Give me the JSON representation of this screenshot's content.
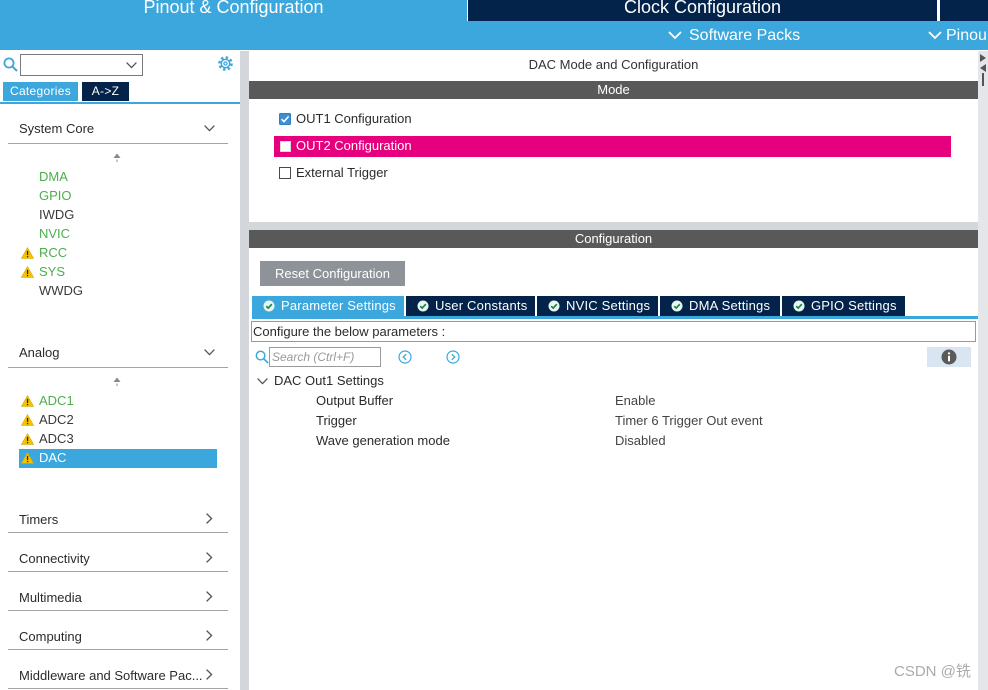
{
  "colors": {
    "accent_blue": "#3ca7dc",
    "navy": "#03234b",
    "enabled_green": "#4cae4c",
    "highlight_magenta": "#e6007e",
    "section_header_gray": "#595959",
    "warning_yellow": "#f5c400"
  },
  "icons": {
    "left_search": "search-icon",
    "left_settings": "gear-icon",
    "peripheral_warning": "warning-icon",
    "tab_status": "check-circle-icon",
    "search_previous": "previous-arrow-icon",
    "search_next": "next-arrow-icon",
    "info": "info-icon"
  },
  "top_tabs": {
    "pinout_label": "Pinout & Configuration",
    "clock_label": "Clock Configuration"
  },
  "sub_menu": {
    "software_packs_label": "Software Packs",
    "pinout_label": "Pinou"
  },
  "left_panel": {
    "search_dropdown_value": "",
    "view_tabs": [
      {
        "label": "Categories",
        "active": true
      },
      {
        "label": "A->Z",
        "active": false
      }
    ],
    "categories": [
      {
        "label": "System Core",
        "expanded": true,
        "items": [
          {
            "label": "DMA",
            "enabled": true,
            "warning": false
          },
          {
            "label": "GPIO",
            "enabled": true,
            "warning": false
          },
          {
            "label": "IWDG",
            "enabled": false,
            "warning": false
          },
          {
            "label": "NVIC",
            "enabled": true,
            "warning": false
          },
          {
            "label": "RCC",
            "enabled": true,
            "warning": true
          },
          {
            "label": "SYS",
            "enabled": true,
            "warning": true
          },
          {
            "label": "WWDG",
            "enabled": false,
            "warning": false
          }
        ]
      },
      {
        "label": "Analog",
        "expanded": true,
        "items": [
          {
            "label": "ADC1",
            "enabled": true,
            "warning": true
          },
          {
            "label": "ADC2",
            "enabled": false,
            "warning": true
          },
          {
            "label": "ADC3",
            "enabled": false,
            "warning": true
          },
          {
            "label": "DAC",
            "enabled": false,
            "warning": true,
            "selected": true
          }
        ]
      },
      {
        "label": "Timers",
        "expanded": false
      },
      {
        "label": "Connectivity",
        "expanded": false
      },
      {
        "label": "Multimedia",
        "expanded": false
      },
      {
        "label": "Computing",
        "expanded": false
      },
      {
        "label": "Middleware and Software Pac...",
        "expanded": false
      }
    ]
  },
  "main": {
    "title": "DAC Mode and Configuration",
    "mode": {
      "header": "Mode",
      "options": [
        {
          "label": "OUT1 Configuration",
          "checked": true,
          "highlighted": false
        },
        {
          "label": "OUT2 Configuration",
          "checked": false,
          "highlighted": true
        },
        {
          "label": "External Trigger",
          "checked": false,
          "highlighted": false
        }
      ]
    },
    "configuration": {
      "header": "Configuration",
      "reset_button": "Reset Configuration",
      "tabs": [
        {
          "label": "Parameter Settings",
          "active": true
        },
        {
          "label": "User Constants",
          "active": false
        },
        {
          "label": "NVIC Settings",
          "active": false
        },
        {
          "label": "DMA Settings",
          "active": false
        },
        {
          "label": "GPIO Settings",
          "active": false
        }
      ],
      "description": "Configure the below parameters :",
      "search_placeholder": "Search (Ctrl+F)",
      "group": {
        "label": "DAC Out1 Settings",
        "expanded": true,
        "parameters": [
          {
            "name": "Output Buffer",
            "value": "Enable"
          },
          {
            "name": "Trigger",
            "value": "Timer 6 Trigger Out event"
          },
          {
            "name": "Wave generation mode",
            "value": "Disabled"
          }
        ]
      }
    }
  },
  "watermark": "CSDN @铣"
}
